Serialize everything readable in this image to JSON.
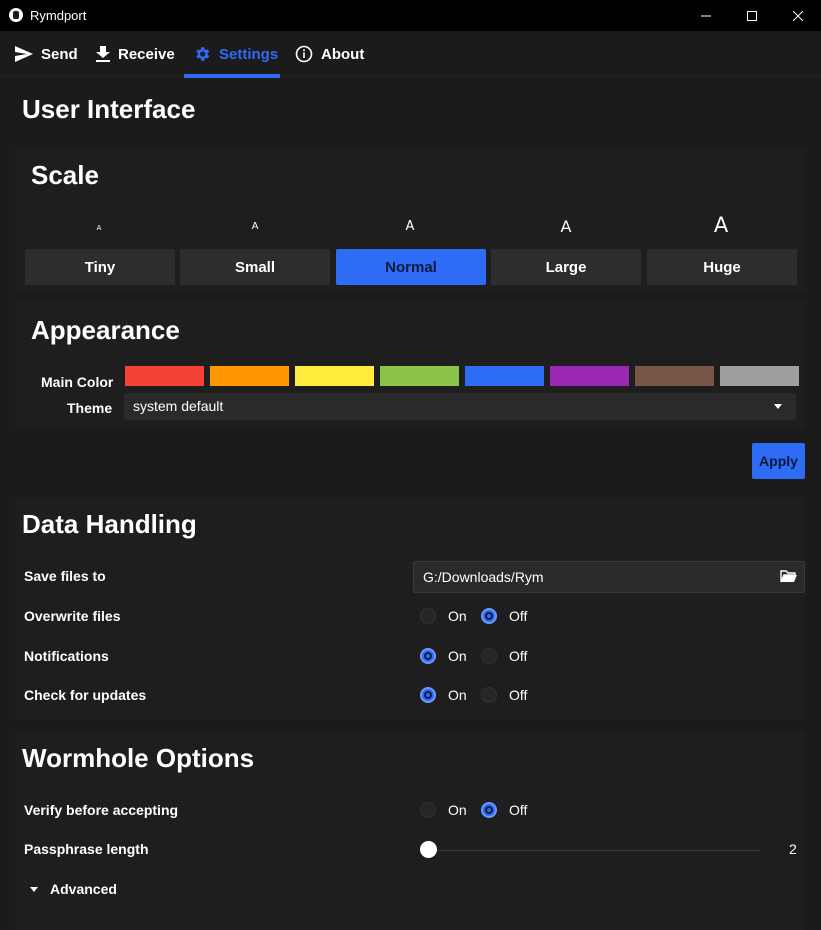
{
  "window": {
    "title": "Rymdport"
  },
  "tabs": [
    {
      "label": "Send"
    },
    {
      "label": "Receive"
    },
    {
      "label": "Settings"
    },
    {
      "label": "About"
    }
  ],
  "active_tab": "Settings",
  "user_interface": {
    "title": "User Interface",
    "scale": {
      "title": "Scale",
      "preview_letter": "A",
      "options": [
        {
          "label": "Tiny"
        },
        {
          "label": "Small"
        },
        {
          "label": "Normal"
        },
        {
          "label": "Large"
        },
        {
          "label": "Huge"
        }
      ],
      "selected": "Normal"
    },
    "appearance": {
      "title": "Appearance",
      "main_color_label": "Main Color",
      "colors": [
        "#f44336",
        "#ff9800",
        "#ffeb3b",
        "#8bc34a",
        "#2e6cf6",
        "#9c27b0",
        "#795548",
        "#9e9e9e"
      ],
      "theme_label": "Theme",
      "theme_value": "system default"
    },
    "apply_label": "Apply"
  },
  "data_handling": {
    "title": "Data Handling",
    "save_files_label": "Save files to",
    "save_path": "G:/Downloads/Rym",
    "rows": [
      {
        "label": "Overwrite files",
        "on_label": "On",
        "off_label": "Off",
        "value": "Off"
      },
      {
        "label": "Notifications",
        "on_label": "On",
        "off_label": "Off",
        "value": "On"
      },
      {
        "label": "Check for updates",
        "on_label": "On",
        "off_label": "Off",
        "value": "On"
      }
    ]
  },
  "wormhole": {
    "title": "Wormhole Options",
    "verify": {
      "label": "Verify before accepting",
      "on_label": "On",
      "off_label": "Off",
      "value": "Off"
    },
    "passphrase": {
      "label": "Passphrase length",
      "value": "2"
    },
    "advanced_label": "Advanced"
  },
  "colors": {
    "accent": "#2e6cf6",
    "background": "#1b1b1b",
    "panel": "#1e1e1e"
  }
}
